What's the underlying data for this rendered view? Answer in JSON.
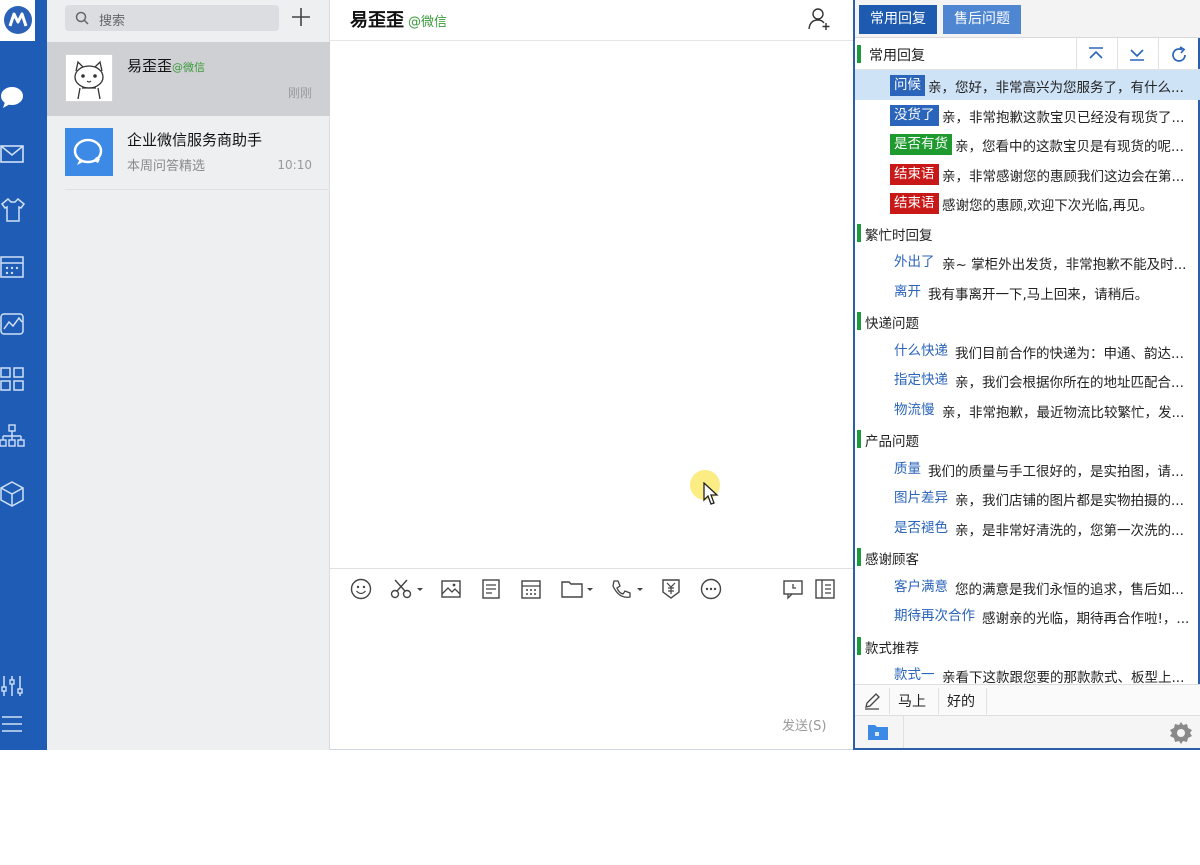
{
  "colors": {
    "rail": "#1f5cb5",
    "accent": "#1e5bb0",
    "category_marker": "#1e9a3e"
  },
  "sidebar": {
    "icons": [
      "app-logo-icon",
      "chat-icon",
      "mail-icon",
      "shirt-icon",
      "calendar-icon",
      "chart-icon",
      "apps-grid-icon",
      "org-chart-icon",
      "cube-icon",
      "sliders-icon",
      "menu-icon"
    ]
  },
  "search": {
    "placeholder": "搜索"
  },
  "conversations": [
    {
      "name": "易歪歪",
      "source": "@微信",
      "time": "刚刚",
      "avatar": "cat-avatar"
    },
    {
      "name": "企业微信服务商助手",
      "preview": "本周问答精选",
      "time": "10:10",
      "avatar": "chat-bubble-avatar"
    }
  ],
  "chat": {
    "title": "易歪歪",
    "source": "@微信",
    "send_label": "发送(S)",
    "toolbar": [
      "emoji-icon",
      "scissors-icon",
      "image-icon",
      "document-icon",
      "calendar-icon",
      "folder-icon",
      "phone-icon",
      "payment-icon",
      "more-icon",
      "message-history-icon",
      "sidebar-icon"
    ]
  },
  "panel": {
    "tabs": [
      "常用回复",
      "售后问题"
    ],
    "category_header": "常用回复",
    "rows": [
      {
        "type": "item",
        "tag": "问候",
        "tag_style": "blue",
        "text": "亲，您好，非常高兴为您服务了，有什么...",
        "selected": true
      },
      {
        "type": "item",
        "tag": "没货了",
        "tag_style": "blue",
        "text": "亲，非常抱歉这款宝贝已经没有现货了..."
      },
      {
        "type": "item",
        "tag": "是否有货",
        "tag_style": "green",
        "text": "亲，您看中的这款宝贝是有现货的呢..."
      },
      {
        "type": "item",
        "tag": "结束语",
        "tag_style": "red",
        "text": "亲，非常感谢您的惠顾我们这边会在第..."
      },
      {
        "type": "item",
        "tag": "结束语",
        "tag_style": "red",
        "text": "感谢您的惠顾,欢迎下次光临,再见。"
      },
      {
        "type": "cat",
        "text": "繁忙时回复"
      },
      {
        "type": "item",
        "tag": "外出了",
        "tag_style": "link",
        "text": "亲~ 掌柜外出发货，非常抱歉不能及时..."
      },
      {
        "type": "item",
        "tag": "离开",
        "tag_style": "link",
        "text": "我有事离开一下,马上回来，请稍后。"
      },
      {
        "type": "cat",
        "text": "快递问题"
      },
      {
        "type": "item",
        "tag": "什么快递",
        "tag_style": "link",
        "text": "我们目前合作的快递为：申通、韵达..."
      },
      {
        "type": "item",
        "tag": "指定快递",
        "tag_style": "link",
        "text": "亲，我们会根据你所在的地址匹配合..."
      },
      {
        "type": "item",
        "tag": "物流慢",
        "tag_style": "link",
        "text": "亲，非常抱歉，最近物流比较繁忙，发..."
      },
      {
        "type": "cat",
        "text": "产品问题"
      },
      {
        "type": "item",
        "tag": "质量",
        "tag_style": "link",
        "text": "我们的质量与手工很好的，是实拍图，请..."
      },
      {
        "type": "item",
        "tag": "图片差异",
        "tag_style": "link",
        "text": "亲，我们店铺的图片都是实物拍摄的..."
      },
      {
        "type": "item",
        "tag": "是否褪色",
        "tag_style": "link",
        "text": "亲，是非常好清洗的，您第一次洗的..."
      },
      {
        "type": "cat",
        "text": "感谢顾客"
      },
      {
        "type": "item",
        "tag": "客户满意",
        "tag_style": "link",
        "text": "您的满意是我们永恒的追求，售后如..."
      },
      {
        "type": "item",
        "tag": "期待再次合作",
        "tag_style": "link",
        "text": "感谢亲的光临，期待再合作啦!，..."
      },
      {
        "type": "cat",
        "text": "款式推荐"
      },
      {
        "type": "item",
        "tag": "款式一",
        "tag_style": "link",
        "text": "亲看下这款跟您要的那款款式、板型上..."
      }
    ],
    "phrases": [
      "马上",
      "好的"
    ]
  }
}
